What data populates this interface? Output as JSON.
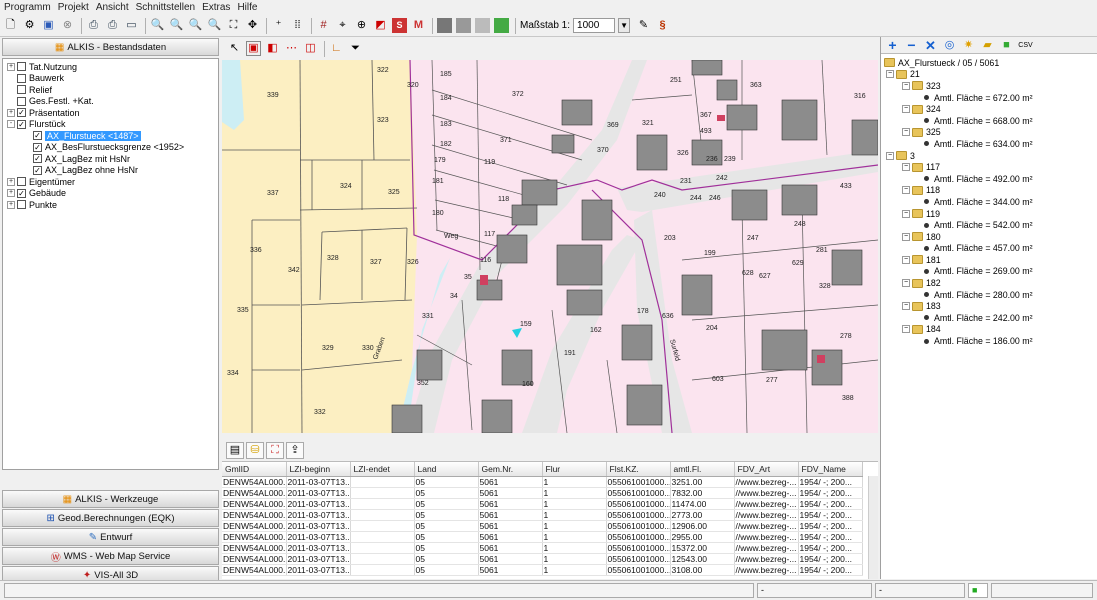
{
  "menu": [
    "Programm",
    "Projekt",
    "Ansicht",
    "Schnittstellen",
    "Extras",
    "Hilfe"
  ],
  "toolbar": {
    "scale_label": "Maßstab 1:",
    "scale_value": "1000",
    "section_icon": "§"
  },
  "left_panel": {
    "header": "ALKIS - Bestandsdaten",
    "tree": [
      {
        "label": "Tat.Nutzung",
        "expander": "+",
        "checked": false,
        "level": 0
      },
      {
        "label": "Bauwerk",
        "expander": "",
        "checked": false,
        "level": 0
      },
      {
        "label": "Relief",
        "expander": "",
        "checked": false,
        "level": 0
      },
      {
        "label": "Ges.Festl. +Kat.",
        "expander": "",
        "checked": false,
        "level": 0
      },
      {
        "label": "Präsentation",
        "expander": "+",
        "checked": true,
        "level": 0
      },
      {
        "label": "Flurstück",
        "expander": "-",
        "checked": true,
        "level": 0
      },
      {
        "label": "AX_Flurstueck <1487>",
        "expander": "",
        "checked": true,
        "level": 1,
        "selected": true
      },
      {
        "label": "AX_BesFlurstuecksgrenze <1952>",
        "expander": "",
        "checked": true,
        "level": 1
      },
      {
        "label": "AX_LagBez mit HsNr",
        "expander": "",
        "checked": true,
        "level": 1
      },
      {
        "label": "AX_LagBez ohne HsNr",
        "expander": "",
        "checked": true,
        "level": 1
      },
      {
        "label": "Eigentümer",
        "expander": "+",
        "checked": false,
        "level": 0
      },
      {
        "label": "Gebäude",
        "expander": "+",
        "checked": true,
        "level": 0
      },
      {
        "label": "Punkte",
        "expander": "+",
        "checked": false,
        "level": 0
      }
    ],
    "buttons": [
      {
        "label": "ALKIS - Werkzeuge",
        "icon": "grid-icon"
      },
      {
        "label": "Geod.Berechnungen (EQK)",
        "icon": "plus-icon"
      },
      {
        "label": "Entwurf",
        "icon": "pencil-icon"
      },
      {
        "label": "WMS - Web Map Service",
        "icon": "wms-icon"
      },
      {
        "label": "VIS-All 3D",
        "icon": "3d-icon"
      }
    ]
  },
  "map": {
    "parcel_labels": [
      "322",
      "320",
      "339",
      "323",
      "337",
      "324",
      "325",
      "336",
      "342",
      "328",
      "327",
      "326",
      "335",
      "329",
      "330",
      "334",
      "332",
      "185",
      "184",
      "183",
      "182",
      "179",
      "181",
      "180",
      "372",
      "371",
      "119",
      "118",
      "117",
      "369",
      "370",
      "116",
      "35",
      "34",
      "331",
      "352",
      "160",
      "159",
      "162",
      "191",
      "178",
      "636",
      "251",
      "321",
      "367",
      "363",
      "493",
      "316",
      "326",
      "236",
      "239",
      "242",
      "231",
      "240",
      "244",
      "246",
      "433",
      "203",
      "247",
      "248",
      "199",
      "281",
      "628",
      "627",
      "629",
      "328",
      "204",
      "278",
      "277",
      "603",
      "388",
      "Weg",
      "Surfeld",
      "Graben"
    ],
    "colors": {
      "yellow": "#fcefc2",
      "pink": "#fbe4ef",
      "road": "#e9e9e9",
      "building": "#8c8c8c",
      "water": "#cdeef4",
      "boundary": "#a0309a"
    }
  },
  "grid": {
    "columns": [
      "GmlID",
      "LZI-beginn",
      "LZI-endet",
      "Land",
      "Gem.Nr.",
      "Flur",
      "Flst.KZ.",
      "amtl.Fl.",
      "FDV_Art",
      "FDV_Name"
    ],
    "rows": [
      [
        "DENW54AL000...",
        "2011-03-07T13...",
        "",
        "05",
        "5061",
        "1",
        "055061001000...",
        "3251.00",
        "//www.bezreg-...",
        "1954/   -; 200..."
      ],
      [
        "DENW54AL000...",
        "2011-03-07T13...",
        "",
        "05",
        "5061",
        "1",
        "055061001000...",
        "7832.00",
        "//www.bezreg-...",
        "1954/   -; 200..."
      ],
      [
        "DENW54AL000...",
        "2011-03-07T13...",
        "",
        "05",
        "5061",
        "1",
        "055061001000...",
        "11474.00",
        "//www.bezreg-...",
        "1954/   -; 200..."
      ],
      [
        "DENW54AL000...",
        "2011-03-07T13...",
        "",
        "05",
        "5061",
        "1",
        "055061001000...",
        "2773.00",
        "//www.bezreg-...",
        "1954/   -; 200..."
      ],
      [
        "DENW54AL000...",
        "2011-03-07T13...",
        "",
        "05",
        "5061",
        "1",
        "055061001000...",
        "12906.00",
        "//www.bezreg-...",
        "1954/   -; 200..."
      ],
      [
        "DENW54AL000...",
        "2011-03-07T13...",
        "",
        "05",
        "5061",
        "1",
        "055061001000...",
        "2955.00",
        "//www.bezreg-...",
        "1954/   -; 200..."
      ],
      [
        "DENW54AL000...",
        "2011-03-07T13...",
        "",
        "05",
        "5061",
        "1",
        "055061001000...",
        "15372.00",
        "//www.bezreg-...",
        "1954/   -; 200..."
      ],
      [
        "DENW54AL000...",
        "2011-03-07T13...",
        "",
        "05",
        "5061",
        "1",
        "055061001000...",
        "12543.00",
        "//www.bezreg-...",
        "1954/   -; 200..."
      ],
      [
        "DENW54AL000...",
        "2011-03-07T13...",
        "",
        "05",
        "5061",
        "1",
        "055061001000...",
        "3108.00",
        "//www.bezreg-...",
        "1954/   -; 200..."
      ]
    ]
  },
  "right_panel": {
    "root": "AX_Flurstueck / 05 / 5061",
    "groups": [
      {
        "flur": "21",
        "items": [
          {
            "nr": "323",
            "flaeche": "Amtl. Fläche = 672.00 m²"
          },
          {
            "nr": "324",
            "flaeche": "Amtl. Fläche = 668.00 m²"
          },
          {
            "nr": "325",
            "flaeche": "Amtl. Fläche = 634.00 m²"
          }
        ]
      },
      {
        "flur": "3",
        "items": [
          {
            "nr": "117",
            "flaeche": "Amtl. Fläche = 492.00 m²"
          },
          {
            "nr": "118",
            "flaeche": "Amtl. Fläche = 344.00 m²"
          },
          {
            "nr": "119",
            "flaeche": "Amtl. Fläche = 542.00 m²"
          },
          {
            "nr": "180",
            "flaeche": "Amtl. Fläche = 457.00 m²"
          },
          {
            "nr": "181",
            "flaeche": "Amtl. Fläche = 269.00 m²"
          },
          {
            "nr": "182",
            "flaeche": "Amtl. Fläche = 280.00 m²"
          },
          {
            "nr": "183",
            "flaeche": "Amtl. Fläche = 242.00 m²"
          },
          {
            "nr": "184",
            "flaeche": "Amtl. Fläche = 186.00 m²"
          }
        ]
      }
    ]
  },
  "statusbar": {
    "field1": "",
    "field2": "-",
    "field3": "-"
  }
}
